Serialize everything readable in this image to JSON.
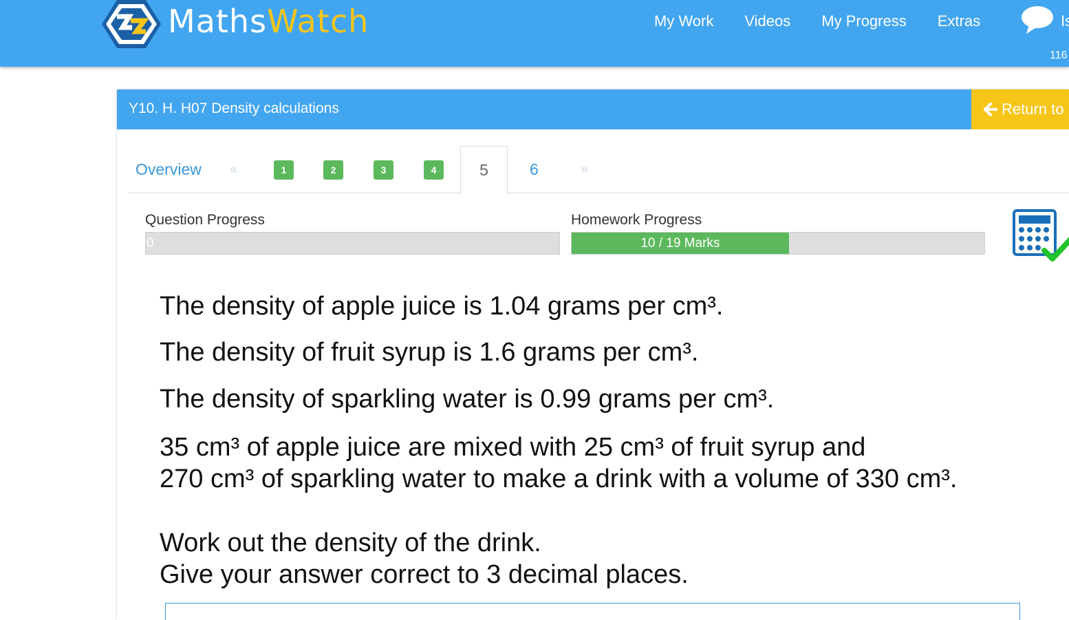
{
  "brand": {
    "name_part1": "Maths",
    "name_part2": "Watch",
    "accent_blue": "#42a5f0",
    "accent_yellow": "#f7c518"
  },
  "nav": {
    "items": [
      {
        "label": "My Work"
      },
      {
        "label": "Videos"
      },
      {
        "label": "My Progress"
      },
      {
        "label": "Extras"
      }
    ],
    "chat_icon": "speech-bubble-icon",
    "chat_label_partial": "Is",
    "counter": "116"
  },
  "panel": {
    "title": "Y10. H. H07 Density calculations",
    "return_label": "Return to",
    "return_icon": "arrow-left-icon"
  },
  "tabs": {
    "overview": "Overview",
    "prev_arrow": "«",
    "next_arrow": "»",
    "completed": [
      "1",
      "2",
      "3",
      "4"
    ],
    "active": "5",
    "remaining": [
      "6"
    ],
    "completed_color": "#5cb85c"
  },
  "progress": {
    "question_label": "Question Progress",
    "question_value": "0",
    "question_fraction": 0,
    "homework_label": "Homework Progress",
    "homework_value": "10 / 19 Marks",
    "homework_marks": 10,
    "homework_total": 19,
    "bar_color": "#5cb85c"
  },
  "calculator_icon": "calculator-allowed-icon",
  "question": {
    "lines": [
      "The density of apple juice is 1.04 grams per cm³.",
      "The density of fruit syrup is 1.6 grams per cm³.",
      "The density of sparkling water is 0.99 grams per cm³.",
      "35 cm³ of apple juice are mixed with 25 cm³ of fruit syrup and",
      "270 cm³ of sparkling water to make a drink with a volume of 330 cm³.",
      "Work out the density of the drink.",
      "Give your answer correct to 3 decimal places."
    ]
  }
}
